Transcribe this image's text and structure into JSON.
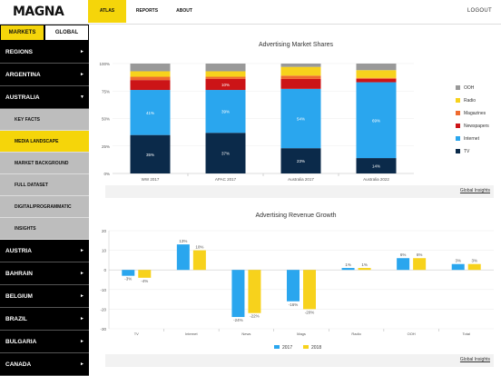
{
  "topbar": {
    "logo": "MAGNA",
    "tabs": [
      "ATLAS",
      "REPORTS",
      "ABOUT"
    ],
    "logout": "LOGOUT"
  },
  "sidebar": {
    "tabs": [
      "MARKETS",
      "GLOBAL"
    ],
    "items": [
      {
        "label": "REGIONS",
        "type": "dark",
        "chev": "►"
      },
      {
        "label": "ARGENTINA",
        "type": "dark",
        "chev": "►"
      },
      {
        "label": "AUSTRALIA",
        "type": "dark",
        "chev": "▼"
      },
      {
        "label": "KEY FACTS",
        "type": "sub"
      },
      {
        "label": "MEDIA LANDSCAPE",
        "type": "sub",
        "active": true
      },
      {
        "label": "MARKET BACKGROUND",
        "type": "sub"
      },
      {
        "label": "FULL DATASET",
        "type": "sub"
      },
      {
        "label": "DIGITAL/PROGRAMMATIC",
        "type": "sub"
      },
      {
        "label": "INSIGHTS",
        "type": "sub"
      },
      {
        "label": "AUSTRIA",
        "type": "dark",
        "chev": "►"
      },
      {
        "label": "BAHRAIN",
        "type": "dark",
        "chev": "►"
      },
      {
        "label": "BELGIUM",
        "type": "dark",
        "chev": "►"
      },
      {
        "label": "BRAZIL",
        "type": "dark",
        "chev": "►"
      },
      {
        "label": "BULGARIA",
        "type": "dark",
        "chev": "►"
      },
      {
        "label": "CANADA",
        "type": "dark",
        "chev": "►"
      }
    ]
  },
  "chart_data": [
    {
      "type": "bar",
      "stacked": true,
      "title": "Advertising Market Shares",
      "categories": [
        "WW 2017",
        "APAC 2017",
        "Australia 2017",
        "Australia 2022"
      ],
      "ylim": [
        0,
        100
      ],
      "yticks": [
        "0%",
        "25%",
        "50%",
        "75%",
        "100%"
      ],
      "series": [
        {
          "name": "TV",
          "color": "#0b2a4a",
          "values": [
            35,
            37,
            23,
            14
          ],
          "labels": [
            "35%",
            "37%",
            "23%",
            "14%"
          ]
        },
        {
          "name": "Internet",
          "color": "#2aa6ee",
          "values": [
            41,
            39,
            54,
            69
          ],
          "labels": [
            "41%",
            "39%",
            "54%",
            "69%"
          ]
        },
        {
          "name": "Newspapers",
          "color": "#cc1417",
          "values": [
            9,
            10,
            9,
            3
          ],
          "labels": [
            "",
            "10%",
            "",
            ""
          ]
        },
        {
          "name": "Magazines",
          "color": "#ef6b2f",
          "values": [
            3,
            2,
            3,
            1
          ],
          "labels": [
            "",
            "",
            "",
            ""
          ]
        },
        {
          "name": "Radio",
          "color": "#f7d21c",
          "values": [
            5,
            5,
            8,
            7
          ],
          "labels": [
            "",
            "",
            "",
            ""
          ]
        },
        {
          "name": "OOH",
          "color": "#999999",
          "values": [
            7,
            7,
            3,
            6
          ],
          "labels": [
            "",
            "",
            "",
            ""
          ]
        }
      ],
      "legend_position": "right"
    },
    {
      "type": "bar",
      "title": "Advertising Revenue Growth",
      "categories": [
        "TV",
        "Internet",
        "News",
        "Mags",
        "Radio",
        "OOH",
        "Total"
      ],
      "ylim": [
        -30,
        20
      ],
      "yticks": [
        "-30",
        "-20",
        "-10",
        "0",
        "10",
        "20"
      ],
      "series": [
        {
          "name": "2017",
          "color": "#2aa6ee",
          "values": [
            -3,
            13,
            -24,
            -16,
            1,
            6,
            3
          ],
          "labels": [
            "-3%",
            "13%",
            "-24%",
            "-16%",
            "1%",
            "6%",
            "3%"
          ]
        },
        {
          "name": "2018",
          "color": "#f7d21c",
          "values": [
            -4,
            10,
            -22,
            -20,
            1,
            6,
            3
          ],
          "labels": [
            "-4%",
            "10%",
            "-22%",
            "-20%",
            "1%",
            "6%",
            "3%"
          ]
        }
      ],
      "legend_position": "bottom"
    }
  ],
  "footer": {
    "link1": "Global Insights",
    "link2": "Global Insights"
  }
}
